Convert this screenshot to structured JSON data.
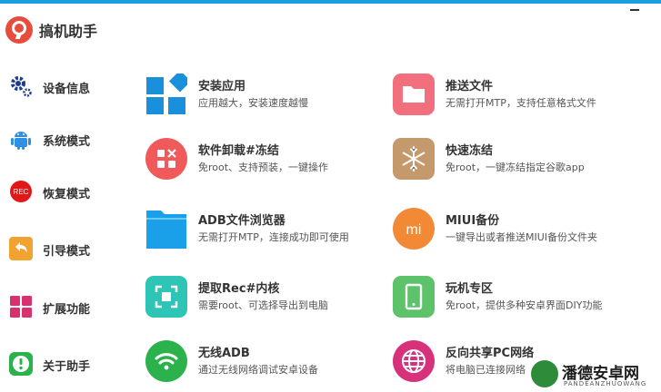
{
  "app": {
    "title": "搞机助手"
  },
  "sidebar": {
    "items": [
      {
        "label": "设备信息",
        "icon": "gear-icon"
      },
      {
        "label": "系统模式",
        "icon": "android-icon"
      },
      {
        "label": "恢复模式",
        "icon": "rec-icon",
        "badge": "REC"
      },
      {
        "label": "引导模式",
        "icon": "back-arrow-icon"
      },
      {
        "label": "扩展功能",
        "icon": "grid-icon"
      },
      {
        "label": "关于助手",
        "icon": "info-icon"
      }
    ]
  },
  "features": [
    {
      "title": "安装应用",
      "desc": "应用越大，安装速度越慢",
      "icon": "app-install-icon"
    },
    {
      "title": "推送文件",
      "desc": "无需打开MTP，支持任意格式文件",
      "icon": "folder-icon"
    },
    {
      "title": "软件卸载#冻结",
      "desc": "免root、支持预装，一键操作",
      "icon": "uninstall-icon"
    },
    {
      "title": "快速冻结",
      "desc": "免root，一键冻结指定谷歌app",
      "icon": "snowflake-icon"
    },
    {
      "title": "ADB文件浏览器",
      "desc": "无需打开MTP，连接成功即可使用",
      "icon": "file-browser-icon"
    },
    {
      "title": "MIUI备份",
      "desc": "一键导出或者推送MIUI备份文件夹",
      "icon": "miui-icon",
      "badge": "mi"
    },
    {
      "title": "提取Rec#内核",
      "desc": "需要root、可选择导出到电脑",
      "icon": "extract-icon"
    },
    {
      "title": "玩机专区",
      "desc": "免root，提供多种安卓界面DIY功能",
      "icon": "phone-icon"
    },
    {
      "title": "无线ADB",
      "desc": "通过无线网络调试安卓设备",
      "icon": "wifi-icon"
    },
    {
      "title": "反向共享PC网络",
      "desc": "将电脑已连接网络",
      "icon": "globe-icon"
    }
  ],
  "watermark": {
    "text": "潘德安卓网",
    "sub": "PANDEANZHUOWANG"
  },
  "colors": {
    "accent": "#1aa0db",
    "blue": "#1a8fdc",
    "red": "#f05a5a",
    "pink": "#f2707e",
    "tan": "#c49a6c",
    "orange": "#f28a35",
    "teal": "#2ec4b6",
    "green": "#5cc36b",
    "green_dark": "#2bb24c",
    "magenta": "#d6317a"
  }
}
